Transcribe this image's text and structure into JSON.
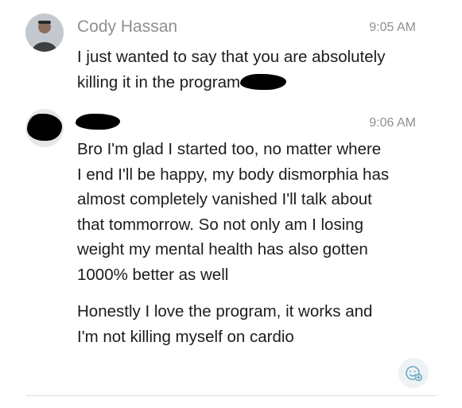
{
  "messages": [
    {
      "sender": "Cody Hassan",
      "time": "9:05 AM",
      "line1": "I just wanted to say that you are absolutely",
      "line2": "killing it in the program"
    },
    {
      "sender": "",
      "time": "9:06 AM",
      "paragraph1_lines": [
        "Bro I'm glad I started too, no matter where",
        "I end I'll be happy, my body dismorphia has",
        "almost completely vanished I'll talk about",
        "that tommorrow.  So not only am I losing",
        "weight my mental health has also gotten",
        "1000% better as well"
      ],
      "paragraph2_lines": [
        "Honestly I love the program, it works and",
        "I'm not killing myself on cardio"
      ]
    }
  ],
  "icons": {
    "reaction": "add-reaction-icon",
    "avatar_1": "avatar-photo",
    "avatar_2": "avatar-redacted"
  },
  "colors": {
    "meta_text": "#8f8f8f",
    "body_text": "#1c1c1c",
    "reaction_bg": "#eef2f4",
    "reaction_icon": "#6aa7c4"
  }
}
